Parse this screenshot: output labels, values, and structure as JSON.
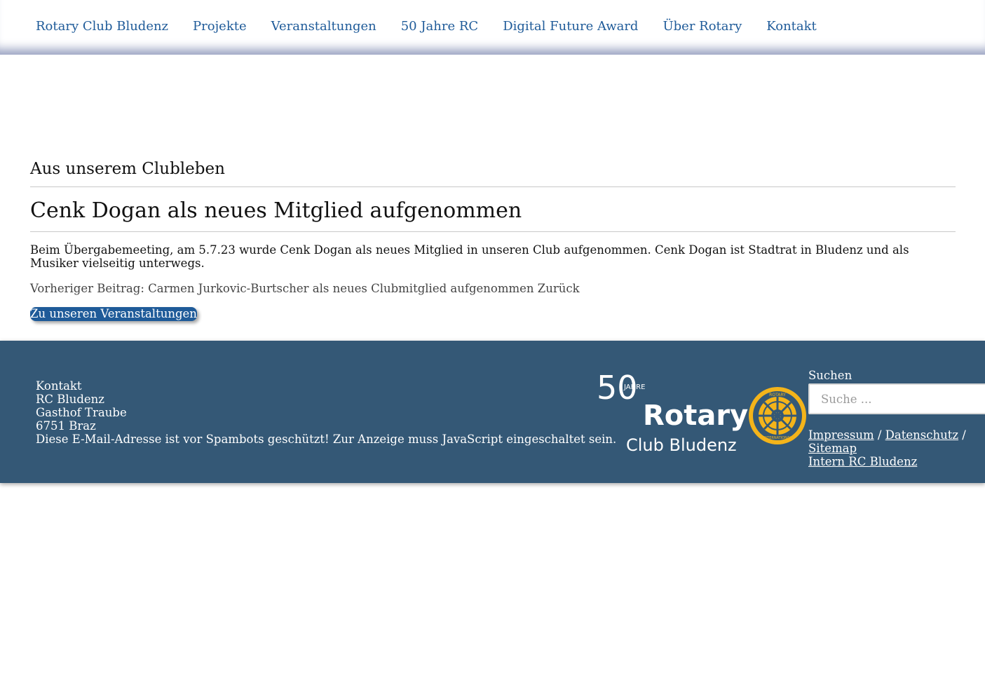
{
  "nav": {
    "items": [
      "Rotary Club Bludenz",
      "Projekte",
      "Veranstaltungen",
      "50 Jahre RC",
      "Digital Future Award",
      "Über Rotary",
      "Kontakt"
    ]
  },
  "article": {
    "category": "Aus unserem Clubleben",
    "title": "Cenk Dogan als neues Mitglied aufgenommen",
    "body": "Beim Übergabemeeting, am 5.7.23 wurde Cenk Dogan als neues Mitglied in unseren Club aufgenommen. Cenk Dogan ist Stadtrat in Bludenz und als Musiker vielseitig unterwegs.",
    "prev_label": "Vorheriger Beitrag:",
    "prev_title": "Carmen Jurkovic-Burtscher als neues Clubmitglied aufgenommen",
    "back_label": "Zurück",
    "cta_label": "Zu unseren Veranstaltungen"
  },
  "footer": {
    "contact": {
      "heading": "Kontakt",
      "lines": [
        "RC Bludenz",
        "Gasthof Traube",
        "6751 Braz",
        "Diese E-Mail-Adresse ist vor Spambots geschützt! Zur Anzeige muss JavaScript eingeschaltet sein."
      ]
    },
    "logo": {
      "number": "50",
      "jahre": "JAHRE",
      "brand": "Rotary",
      "sub": "Club Bludenz",
      "wheel_top": "ROTARY",
      "wheel_bottom": "INTERNATIONAL"
    },
    "search": {
      "label": "Suchen",
      "placeholder": "Suche ..."
    },
    "legal": {
      "impressum": "Impressum",
      "sep": "/",
      "datenschutz": "Datenschutz",
      "sitemap": "Sitemap",
      "intern": "Intern RC Bludenz"
    }
  },
  "colors": {
    "nav_link": "#1f5b99",
    "footer_bg": "#345876",
    "rotary_gold": "#f4b41a",
    "button_bg": "#1f5b99"
  }
}
